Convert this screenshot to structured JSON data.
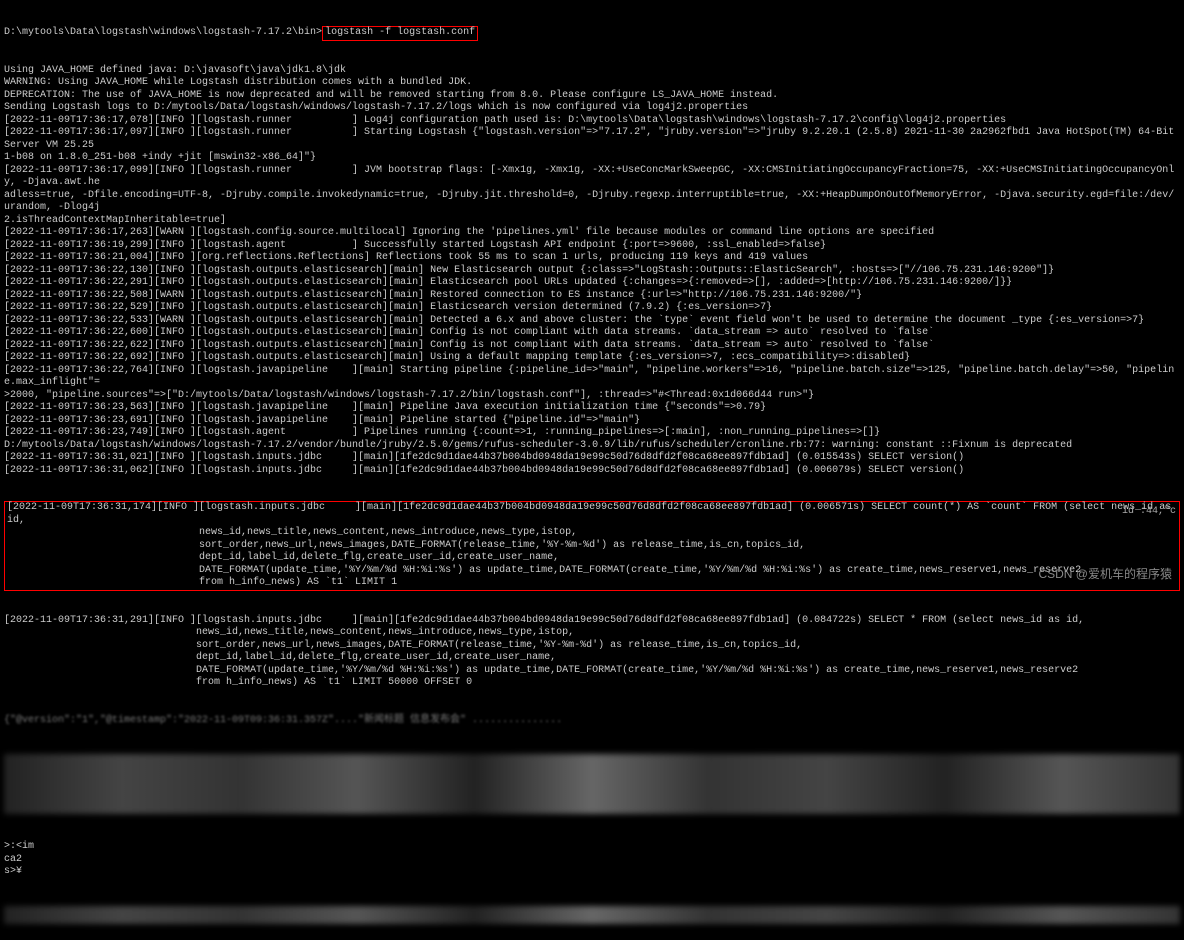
{
  "command_prefix": "D:\\mytools\\Data\\logstash\\windows\\logstash-7.17.2\\bin>",
  "command_highlighted": "logstash -f logstash.conf",
  "lines": [
    "Using JAVA_HOME defined java: D:\\javasoft\\java\\jdk1.8\\jdk",
    "WARNING: Using JAVA_HOME while Logstash distribution comes with a bundled JDK.",
    "DEPRECATION: The use of JAVA_HOME is now deprecated and will be removed starting from 8.0. Please configure LS_JAVA_HOME instead.",
    "Sending Logstash logs to D:/mytools/Data/logstash/windows/logstash-7.17.2/logs which is now configured via log4j2.properties",
    "[2022-11-09T17:36:17,078][INFO ][logstash.runner          ] Log4j configuration path used is: D:\\mytools\\Data\\logstash\\windows\\logstash-7.17.2\\config\\log4j2.properties",
    "[2022-11-09T17:36:17,097][INFO ][logstash.runner          ] Starting Logstash {\"logstash.version\"=>\"7.17.2\", \"jruby.version\"=>\"jruby 9.2.20.1 (2.5.8) 2021-11-30 2a2962fbd1 Java HotSpot(TM) 64-Bit Server VM 25.25",
    "1-b08 on 1.8.0_251-b08 +indy +jit [mswin32-x86_64]\"}",
    "[2022-11-09T17:36:17,099][INFO ][logstash.runner          ] JVM bootstrap flags: [-Xmx1g, -Xmx1g, -XX:+UseConcMarkSweepGC, -XX:CMSInitiatingOccupancyFraction=75, -XX:+UseCMSInitiatingOccupancyOnly, -Djava.awt.he",
    "adless=true, -Dfile.encoding=UTF-8, -Djruby.compile.invokedynamic=true, -Djruby.jit.threshold=0, -Djruby.regexp.interruptible=true, -XX:+HeapDumpOnOutOfMemoryError, -Djava.security.egd=file:/dev/urandom, -Dlog4j",
    "2.isThreadContextMapInheritable=true]",
    "[2022-11-09T17:36:17,263][WARN ][logstash.config.source.multilocal] Ignoring the 'pipelines.yml' file because modules or command line options are specified",
    "[2022-11-09T17:36:19,299][INFO ][logstash.agent           ] Successfully started Logstash API endpoint {:port=>9600, :ssl_enabled=>false}",
    "[2022-11-09T17:36:21,004][INFO ][org.reflections.Reflections] Reflections took 55 ms to scan 1 urls, producing 119 keys and 419 values",
    "[2022-11-09T17:36:22,130][INFO ][logstash.outputs.elasticsearch][main] New Elasticsearch output {:class=>\"LogStash::Outputs::ElasticSearch\", :hosts=>[\"//106.75.231.146:9200\"]}",
    "[2022-11-09T17:36:22,291][INFO ][logstash.outputs.elasticsearch][main] Elasticsearch pool URLs updated {:changes=>{:removed=>[], :added=>[http://106.75.231.146:9200/]}}",
    "[2022-11-09T17:36:22,508][WARN ][logstash.outputs.elasticsearch][main] Restored connection to ES instance {:url=>\"http://106.75.231.146:9200/\"}",
    "[2022-11-09T17:36:22,529][INFO ][logstash.outputs.elasticsearch][main] Elasticsearch version determined (7.9.2) {:es_version=>7}",
    "[2022-11-09T17:36:22,533][WARN ][logstash.outputs.elasticsearch][main] Detected a 6.x and above cluster: the `type` event field won't be used to determine the document _type {:es_version=>7}",
    "[2022-11-09T17:36:22,600][INFO ][logstash.outputs.elasticsearch][main] Config is not compliant with data streams. `data_stream => auto` resolved to `false`",
    "[2022-11-09T17:36:22,622][INFO ][logstash.outputs.elasticsearch][main] Config is not compliant with data streams. `data_stream => auto` resolved to `false`",
    "[2022-11-09T17:36:22,692][INFO ][logstash.outputs.elasticsearch][main] Using a default mapping template {:es_version=>7, :ecs_compatibility=>:disabled}",
    "[2022-11-09T17:36:22,764][INFO ][logstash.javapipeline    ][main] Starting pipeline {:pipeline_id=>\"main\", \"pipeline.workers\"=>16, \"pipeline.batch.size\"=>125, \"pipeline.batch.delay\"=>50, \"pipeline.max_inflight\"=",
    ">2000, \"pipeline.sources\"=>[\"D:/mytools/Data/logstash/windows/logstash-7.17.2/bin/logstash.conf\"], :thread=>\"#<Thread:0x1d066d44 run>\"}",
    "[2022-11-09T17:36:23,563][INFO ][logstash.javapipeline    ][main] Pipeline Java execution initialization time {\"seconds\"=>0.79}",
    "[2022-11-09T17:36:23,691][INFO ][logstash.javapipeline    ][main] Pipeline started {\"pipeline.id\"=>\"main\"}",
    "[2022-11-09T17:36:23,749][INFO ][logstash.agent           ] Pipelines running {:count=>1, :running_pipelines=>[:main], :non_running_pipelines=>[]}",
    "D:/mytools/Data/logstash/windows/logstash-7.17.2/vendor/bundle/jruby/2.5.0/gems/rufus-scheduler-3.0.9/lib/rufus/scheduler/cronline.rb:77: warning: constant ::Fixnum is deprecated",
    "[2022-11-09T17:36:31,021][INFO ][logstash.inputs.jdbc     ][main][1fe2dc9d1dae44b37b004bd0948da19e99c50d76d8dfd2f08ca68ee897fdb1ad] (0.015543s) SELECT version()",
    "[2022-11-09T17:36:31,062][INFO ][logstash.inputs.jdbc     ][main][1fe2dc9d1dae44b37b004bd0948da19e99c50d76d8dfd2f08ca68ee897fdb1ad] (0.006079s) SELECT version()"
  ],
  "highlighted_block": [
    "[2022-11-09T17:36:31,174][INFO ][logstash.inputs.jdbc     ][main][1fe2dc9d1dae44b37b004bd0948da19e99c50d76d8dfd2f08ca68ee897fdb1ad] (0.006571s) SELECT count(*) AS `count` FROM (select news_id as id,",
    "                                news_id,news_title,news_content,news_introduce,news_type,istop,",
    "                                sort_order,news_url,news_images,DATE_FORMAT(release_time,'%Y-%m-%d') as release_time,is_cn,topics_id,",
    "                                dept_id,label_id,delete_flg,create_user_id,create_user_name,",
    "                                DATE_FORMAT(update_time,'%Y/%m/%d %H:%i:%s') as update_time,DATE_FORMAT(create_time,'%Y/%m/%d %H:%i:%s') as create_time,news_reserve1,news_reserve2",
    "                                from h_info_news) AS `t1` LIMIT 1"
  ],
  "lines_after": [
    "[2022-11-09T17:36:31,291][INFO ][logstash.inputs.jdbc     ][main][1fe2dc9d1dae44b37b004bd0948da19e99c50d76d8dfd2f08ca68ee897fdb1ad] (0.084722s) SELECT * FROM (select news_id as id,",
    "                                news_id,news_title,news_content,news_introduce,news_type,istop,",
    "                                sort_order,news_url,news_images,DATE_FORMAT(release_time,'%Y-%m-%d') as release_time,is_cn,topics_id,",
    "                                dept_id,label_id,delete_flg,create_user_id,create_user_name,",
    "                                DATE_FORMAT(update_time,'%Y/%m/%d %H:%i:%s') as update_time,DATE_FORMAT(create_time,'%Y/%m/%d %H:%i:%s') as create_time,news_reserve1,news_reserve2",
    "                                from h_info_news) AS `t1` LIMIT 50000 OFFSET 0"
  ],
  "faded_line": "{\"@version\":\"1\",\"@timestamp\":\"2022-11-09T09:36:31.357Z\"....\"新闻标题 信息发布会\" ...............",
  "small_right": "id :44,\"c",
  "bottom_fragments": [
    ">:<im",
    "ca2",
    "s>¥"
  ],
  "watermark": "CSDN @爱机车的程序猿"
}
